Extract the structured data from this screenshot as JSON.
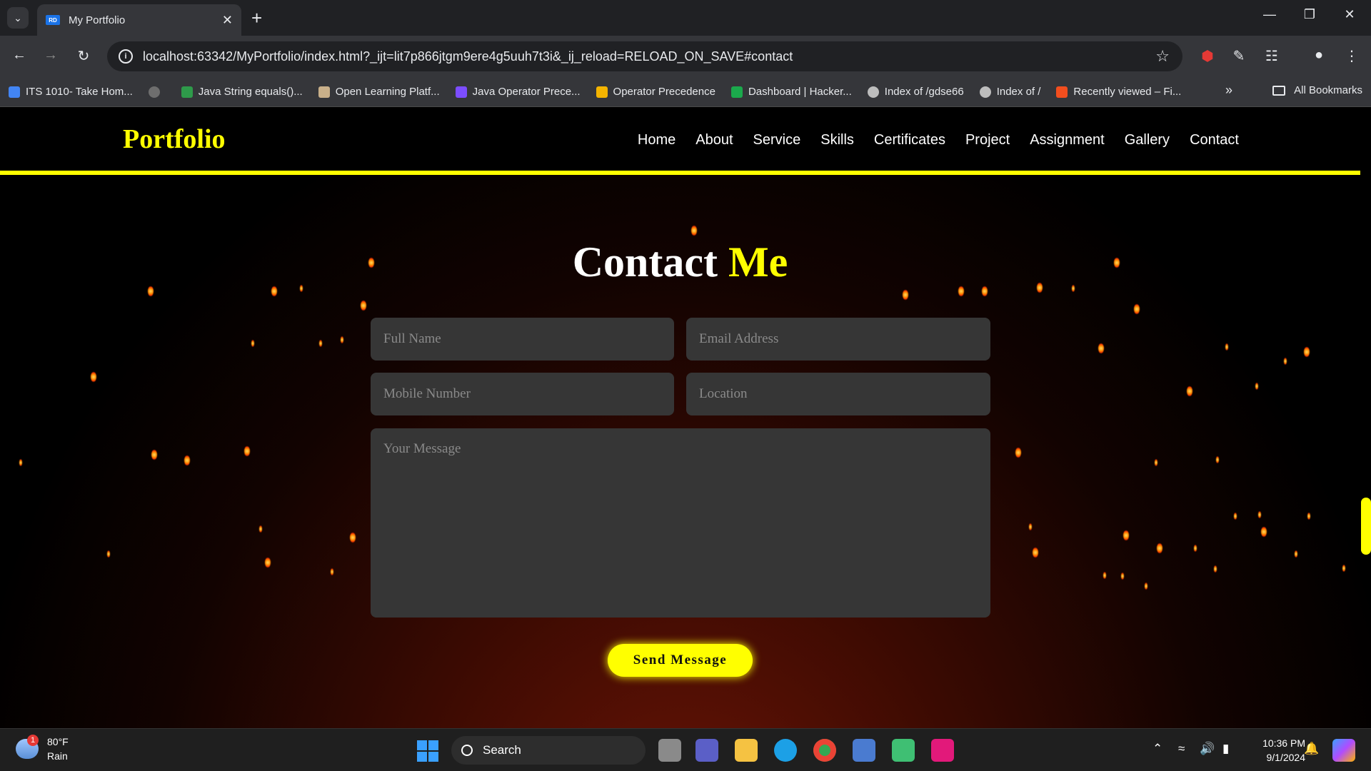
{
  "browser": {
    "tab_title": "My Portfolio",
    "tab_favicon_text": "RD",
    "url": "localhost:63342/MyPortfolio/index.html?_ijt=lit7p866jtgm9ere4g5uuh7t3i&_ij_reload=RELOAD_ON_SAVE#contact",
    "bookmarks": [
      {
        "label": "ITS 1010- Take Hom...",
        "icon": "form-icon",
        "color": "#4285f4"
      },
      {
        "label": "",
        "icon": "github-icon",
        "color": "#6e6e6e"
      },
      {
        "label": "Java String equals()...",
        "icon": "w-icon",
        "color": "#2e9a4a"
      },
      {
        "label": "Open Learning Platf...",
        "icon": "owl-icon",
        "color": "#c9b08a"
      },
      {
        "label": "Java Operator Prece...",
        "icon": "bolt-icon",
        "color": "#7c4dff"
      },
      {
        "label": "Operator Precedence",
        "icon": "bee-icon",
        "color": "#f4b400"
      },
      {
        "label": "Dashboard | Hacker...",
        "icon": "hackerrank-icon",
        "color": "#1ba94c"
      },
      {
        "label": "Index of /gdse66",
        "icon": "globe-icon",
        "color": "#bdbdbd"
      },
      {
        "label": "Index of /",
        "icon": "globe-icon",
        "color": "#bdbdbd"
      },
      {
        "label": "Recently viewed – Fi...",
        "icon": "figma-icon",
        "color": "#f24e1e"
      }
    ],
    "all_bookmarks_label": "All Bookmarks"
  },
  "site": {
    "logo": "Portfolio",
    "nav": [
      "Home",
      "About",
      "Service",
      "Skills",
      "Certificates",
      "Project",
      "Assignment",
      "Gallery",
      "Contact"
    ],
    "heading_main": "Contact",
    "heading_highlight": "Me",
    "form": {
      "full_name_placeholder": "Full Name",
      "email_placeholder": "Email Address",
      "mobile_placeholder": "Mobile Number",
      "location_placeholder": "Location",
      "message_placeholder": "Your Message",
      "submit_label": "Send Message"
    },
    "colors": {
      "accent": "#ffff00",
      "background": "#000000",
      "field_bg": "#363636"
    }
  },
  "taskbar": {
    "weather_temp": "80°F",
    "weather_desc": "Rain",
    "weather_badge": "1",
    "search_label": "Search",
    "time": "10:36 PM",
    "date": "9/1/2024"
  }
}
